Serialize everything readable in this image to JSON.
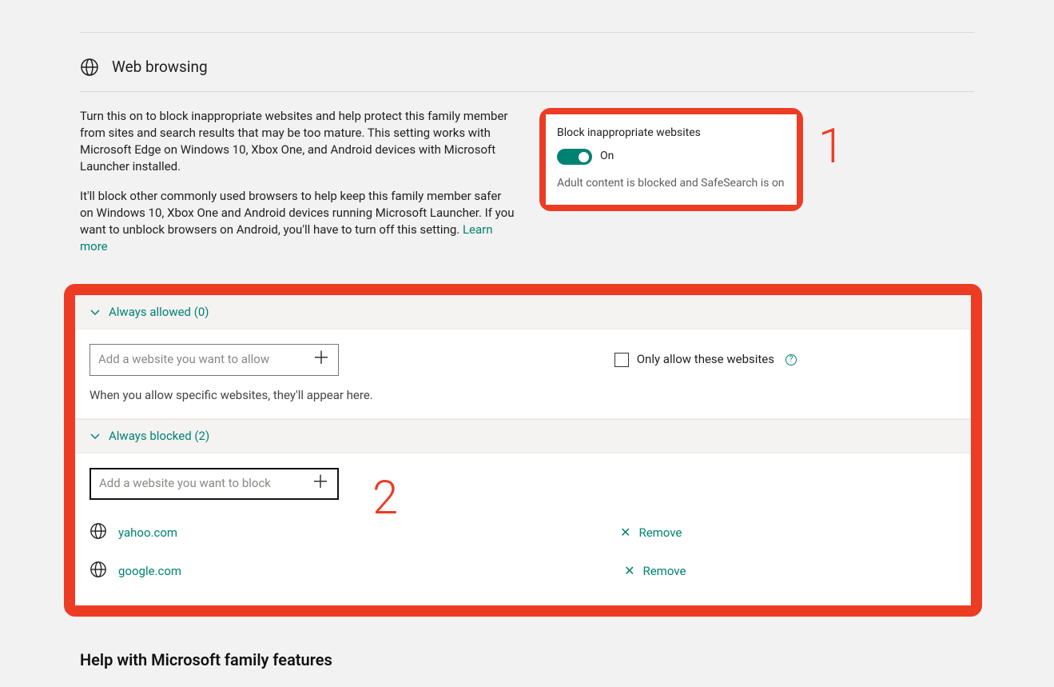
{
  "section_title": "Web browsing",
  "desc1": "Turn this on to block inappropriate websites and help protect this family member from sites and search results that may be too mature. This setting works with Microsoft Edge on Windows 10, Xbox One, and Android devices with Microsoft Launcher installed.",
  "desc2": "It'll block other commonly used browsers to help keep this family member safer on Windows 10, Xbox One and Android devices running Microsoft Launcher. If you want to unblock browsers on Android, you'll have to turn off this setting.  ",
  "learn_more": "Learn more",
  "block_card": {
    "label": "Block inappropriate websites",
    "state": "On",
    "desc": "Adult content is blocked and SafeSearch is on"
  },
  "annotations": {
    "one": "1",
    "two": "2"
  },
  "allowed": {
    "header": "Always allowed (0)",
    "placeholder": "Add a website you want to allow",
    "helper": "When you allow specific websites, they'll appear here.",
    "only_allow_label": "Only allow these websites"
  },
  "blocked": {
    "header": "Always blocked (2)",
    "placeholder": "Add a website you want to block",
    "sites": [
      {
        "name": "yahoo.com",
        "remove": "Remove"
      },
      {
        "name": "google.com",
        "remove": "Remove"
      }
    ]
  },
  "help_title": "Help with Microsoft family features"
}
